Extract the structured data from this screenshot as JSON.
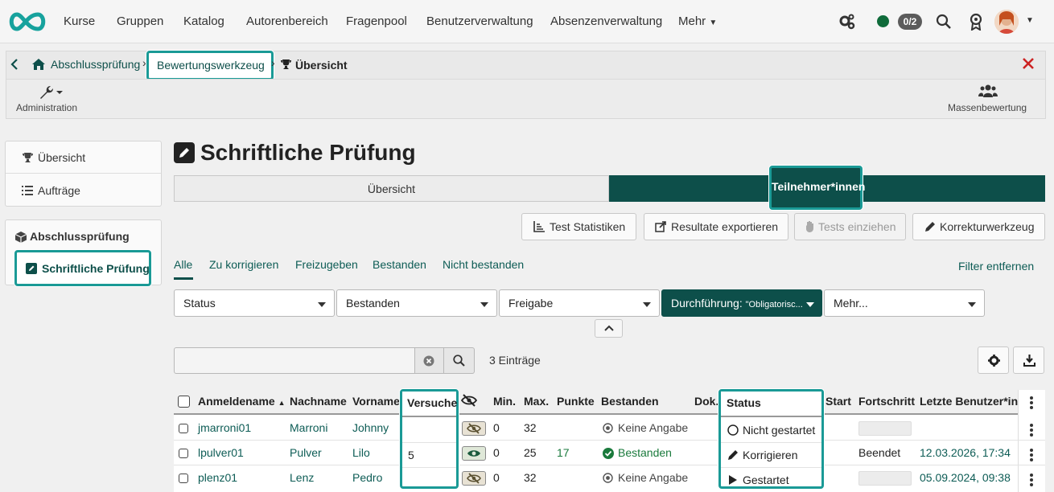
{
  "topnav": {
    "items": [
      "Kurse",
      "Gruppen",
      "Katalog",
      "Autorenbereich",
      "Fragenpool",
      "Benutzerverwaltung",
      "Absenzenverwaltung",
      "Mehr"
    ],
    "counter": "0/2"
  },
  "breadcrumb": {
    "home": "Abschlussprüfung",
    "tool": "Bewertungswerkzeug",
    "current": "Übersicht"
  },
  "toolbar": {
    "admin": "Administration",
    "mass": "Massenbewertung"
  },
  "sidebar": {
    "items": [
      "Übersicht",
      "Aufträge"
    ],
    "group_title": "Abschlussprüfung",
    "active": "Schriftliche Prüfung"
  },
  "page": {
    "title": "Schriftliche Prüfung",
    "tabs": [
      "Übersicht",
      "Teilnehmer*innen"
    ]
  },
  "actions": [
    "Test Statistiken",
    "Resultate exportieren",
    "Tests einziehen",
    "Korrekturwerkzeug"
  ],
  "filter_tabs": [
    "Alle",
    "Zu korrigieren",
    "Freizugeben",
    "Bestanden",
    "Nicht bestanden"
  ],
  "filter_remove": "Filter entfernen",
  "selects": [
    "Status",
    "Bestanden",
    "Freigabe"
  ],
  "durchfuehrung": {
    "label": "Durchführung:",
    "value": "\"Obligatorisc..."
  },
  "more_select": "Mehr...",
  "entries": "3 Einträge",
  "table": {
    "headers": {
      "username": "Anmeldename",
      "lastname": "Nachname",
      "firstname": "Vorname",
      "attempts": "Versuche",
      "min": "Min.",
      "max": "Max.",
      "points": "Punkte",
      "passed": "Bestanden",
      "doc": "Dok.",
      "status": "Status",
      "start": "Start",
      "progress": "Fortschritt",
      "lastuser": "Letzte Benutzer*in"
    },
    "rows": [
      {
        "username": "jmarroni01",
        "lastname": "Marroni",
        "firstname": "Johnny",
        "attempts": "",
        "min": "0",
        "max": "32",
        "points": "",
        "passed": "Keine Angabe",
        "status": "Nicht gestartet",
        "progress": "",
        "lastuser": ""
      },
      {
        "username": "lpulver01",
        "lastname": "Pulver",
        "firstname": "Lilo",
        "attempts": "5",
        "min": "0",
        "max": "25",
        "points": "17",
        "passed": "Bestanden",
        "status": "Korrigieren",
        "progress": "Beendet",
        "lastuser": "12.03.2026, 17:34"
      },
      {
        "username": "plenz01",
        "lastname": "Lenz",
        "firstname": "Pedro",
        "attempts": "",
        "min": "0",
        "max": "32",
        "points": "",
        "passed": "Keine Angabe",
        "status": "Gestartet",
        "progress": "",
        "lastuser": "05.09.2024, 09:38"
      }
    ]
  },
  "colors": {
    "brand": "#0d4f4a",
    "highlight": "#1a9a96",
    "passed": "#1a7a3c",
    "close": "#cc2222",
    "online": "#0f6b3a"
  }
}
